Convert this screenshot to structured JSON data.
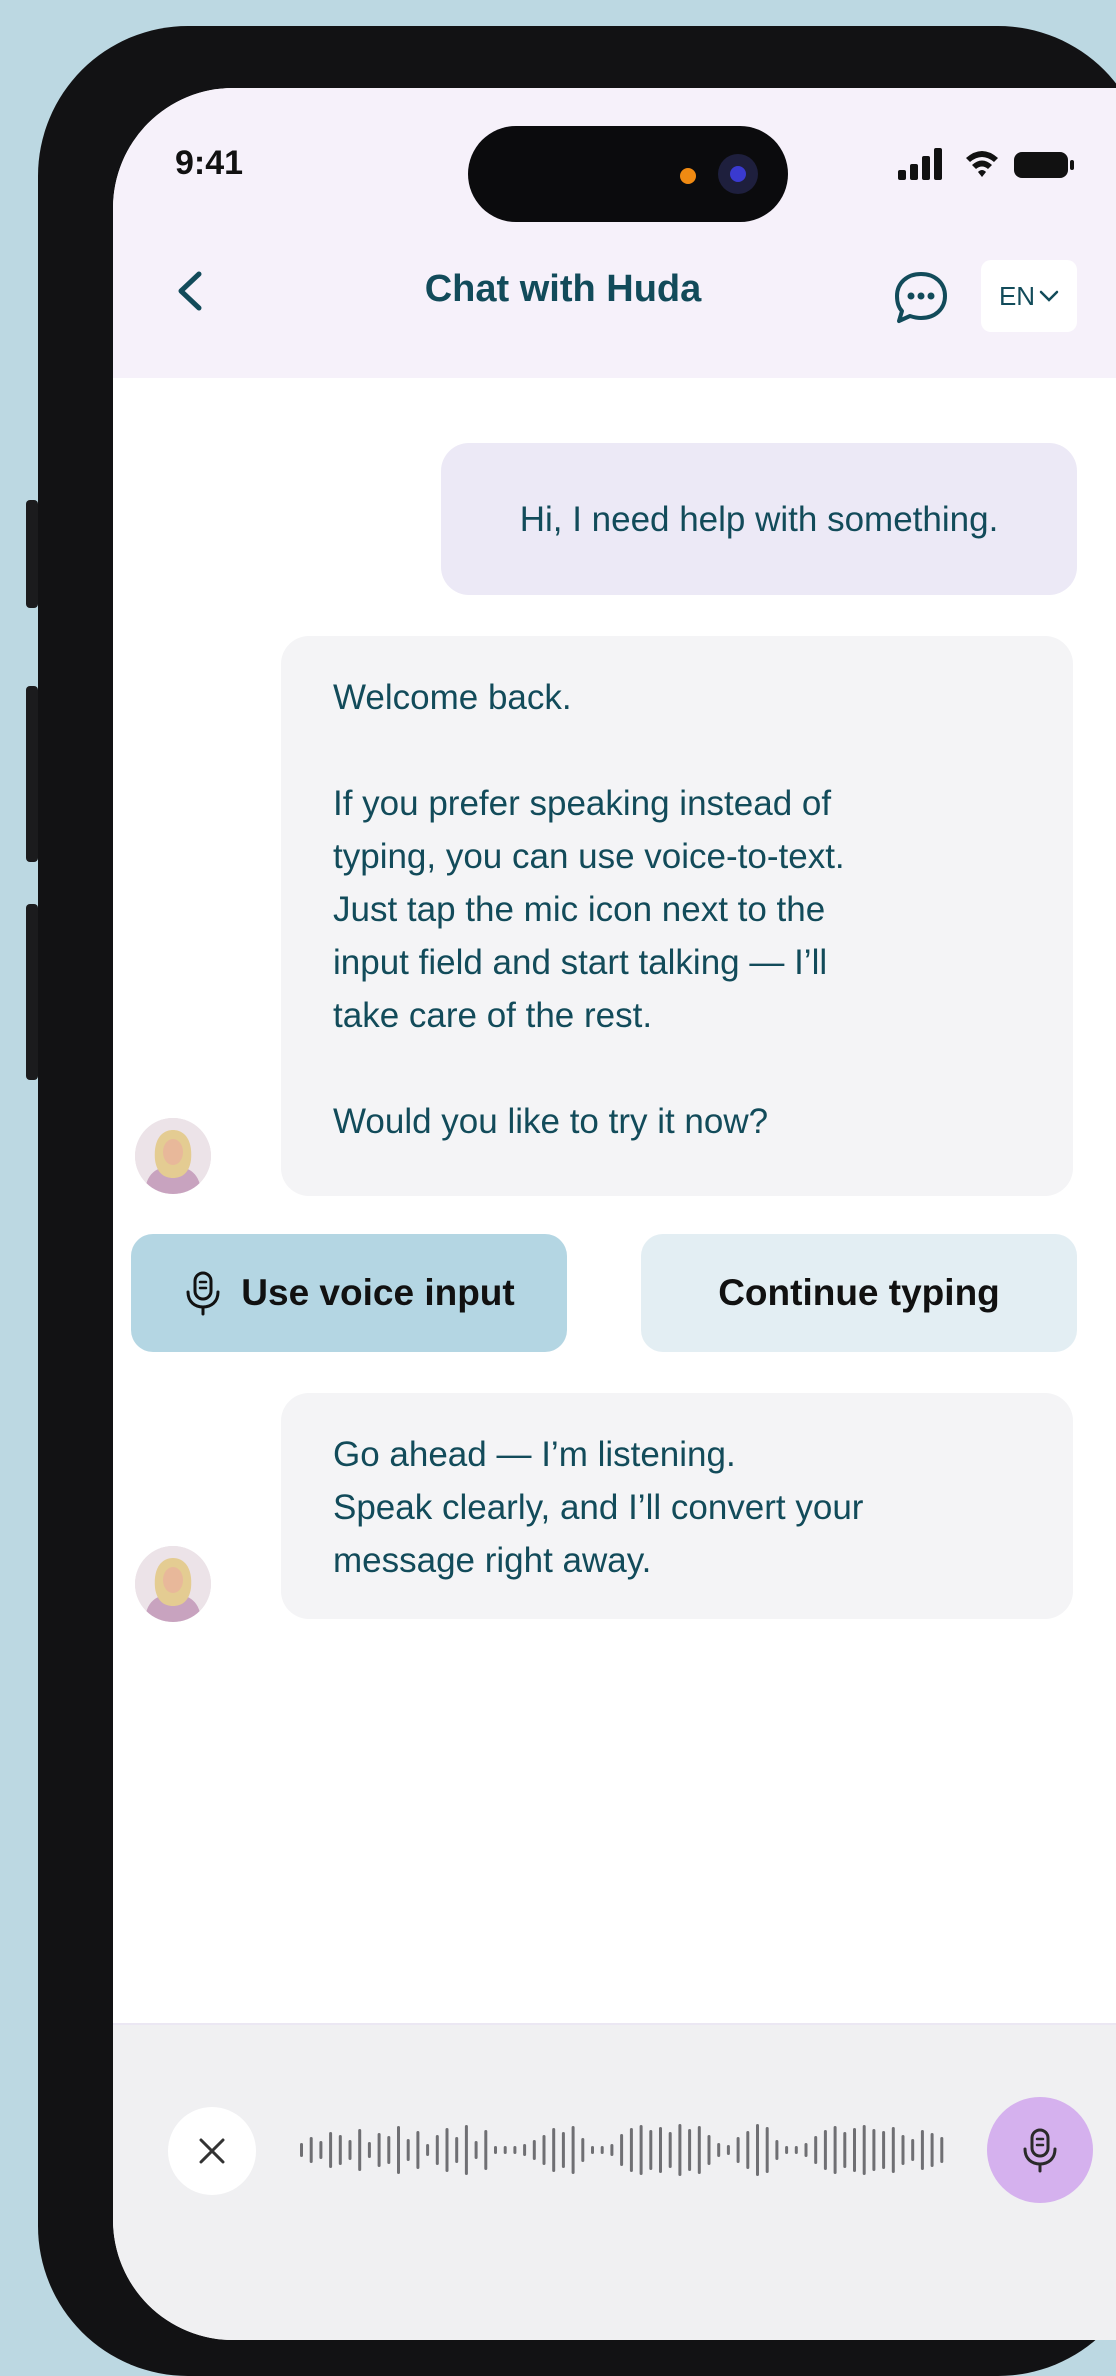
{
  "status_bar": {
    "time": "9:41"
  },
  "header": {
    "title": "Chat with Huda",
    "language": "EN"
  },
  "messages": {
    "user_1": "Hi, I need help with something.",
    "bot_1": {
      "greeting": "Welcome back.",
      "lines": [
        "If you prefer speaking instead of",
        "typing, you can use voice-to-text.",
        "Just tap the mic icon next to the",
        "input field and start talking — I’ll",
        "take care of the rest."
      ],
      "question": "Would you like to try it now?"
    },
    "bot_2": {
      "lines": [
        "Go ahead — I’m listening.",
        "Speak clearly, and I’ll convert your",
        "message right away."
      ]
    }
  },
  "quick_replies": {
    "voice": "Use voice input",
    "typing": "Continue typing"
  },
  "colors": {
    "accent": "#124b5a",
    "header_bg": "#f6f1fa",
    "user_bubble": "#ece9f6",
    "bot_bubble": "#f4f4f6",
    "voice_button": "#b4d6e3",
    "typing_button": "#e3eef3",
    "mic_button": "#d5b1ee"
  },
  "icons": {
    "back": "chevron-left-icon",
    "chat": "chat-bubble-icon",
    "language_chevron": "chevron-down-icon",
    "mic": "microphone-icon",
    "close": "close-icon",
    "waveform": "waveform-icon"
  }
}
